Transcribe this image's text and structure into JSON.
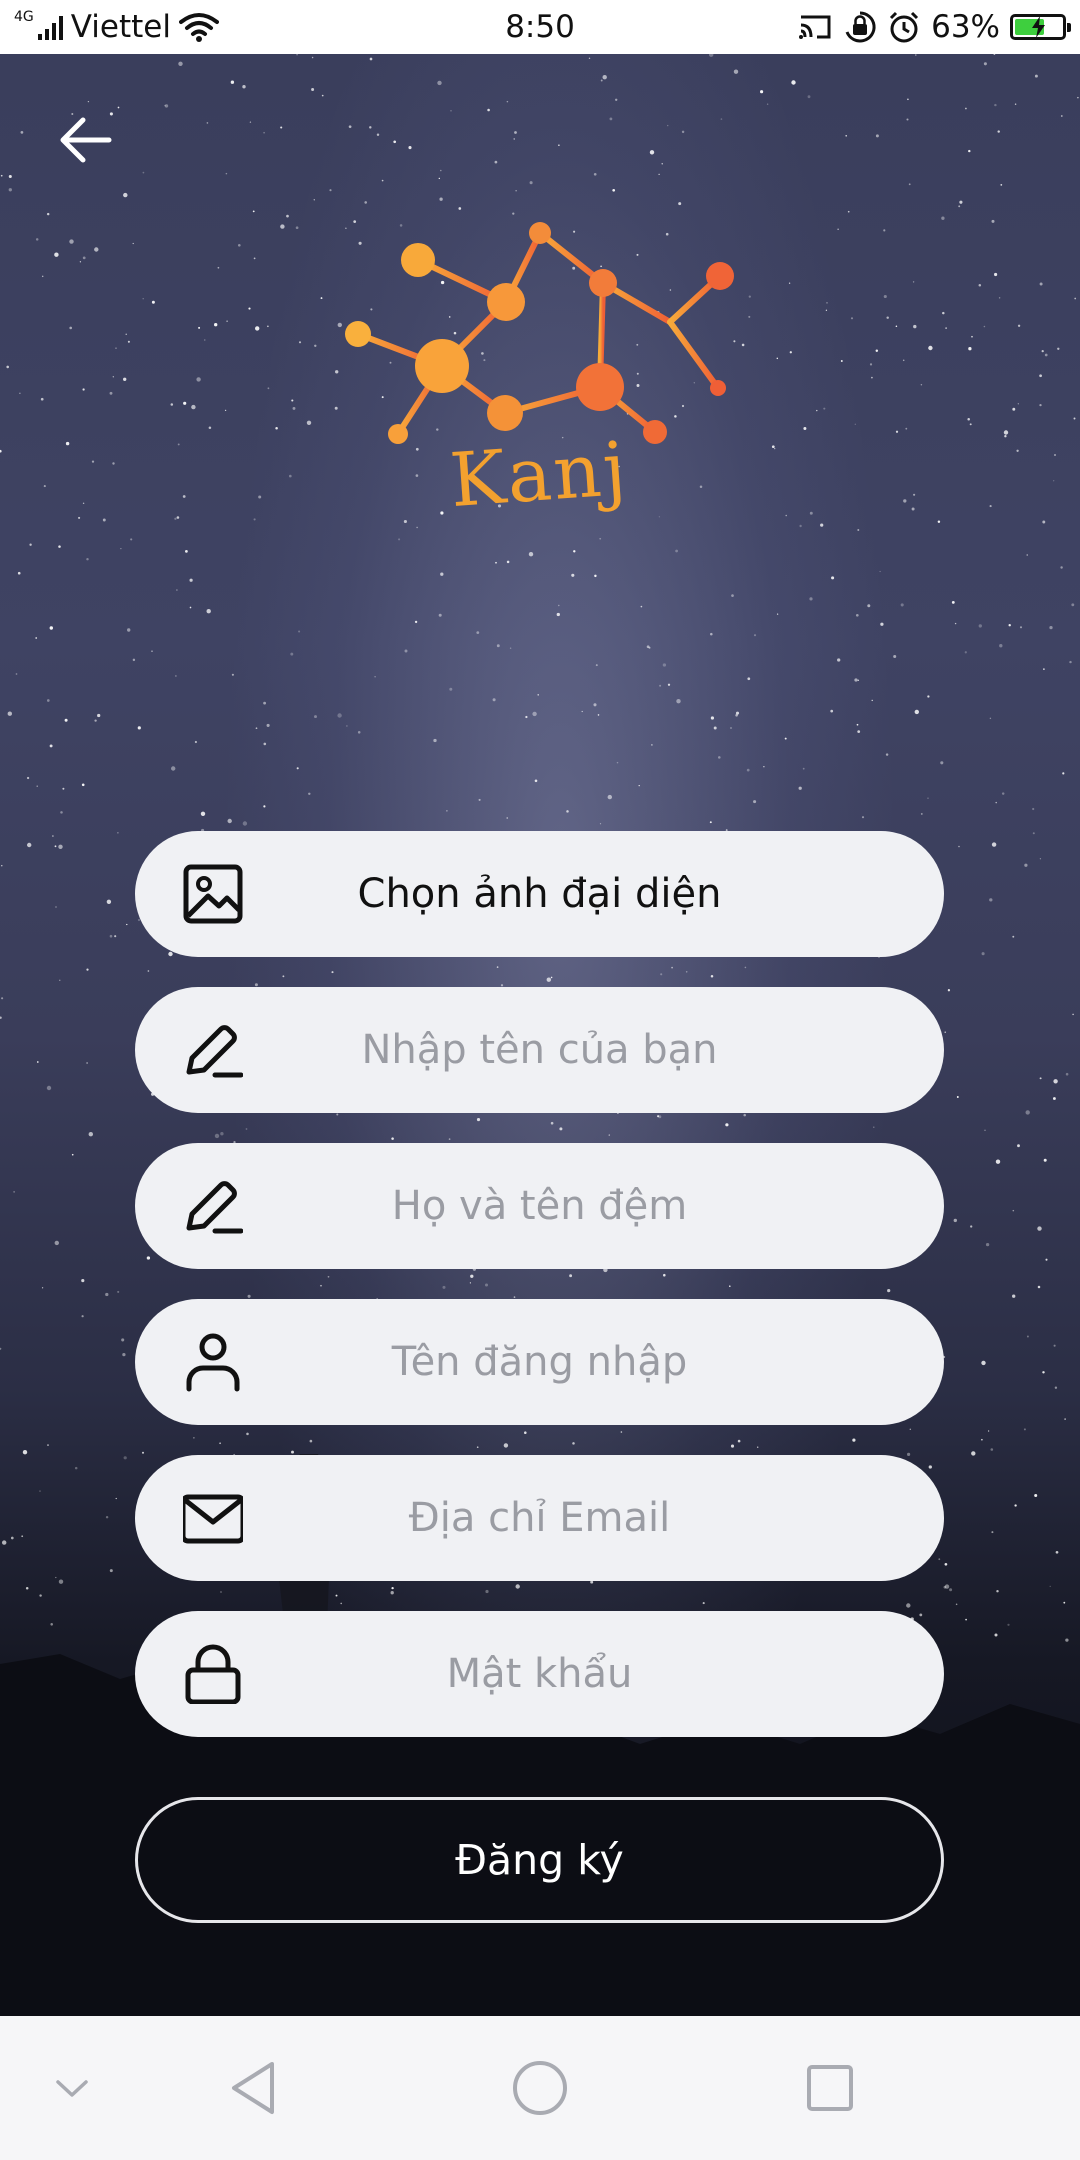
{
  "status_bar": {
    "network_type": "4G",
    "carrier": "Viettel",
    "time": "8:50",
    "battery_percent": "63%",
    "battery_level": 0.63,
    "icons": [
      "signal-icon",
      "wifi-icon",
      "cast-icon",
      "rotation-lock-icon",
      "alarm-icon",
      "battery-icon"
    ]
  },
  "header": {
    "back_icon": "arrow-left-icon"
  },
  "logo": {
    "text": "Kanj",
    "color": "#f3a12f",
    "accent": "#f26a3b"
  },
  "form": {
    "avatar": {
      "label": "Chọn ảnh đại diện",
      "icon": "image-icon"
    },
    "first_name": {
      "placeholder": "Nhập tên của bạn",
      "value": "",
      "icon": "pencil-icon"
    },
    "last_name": {
      "placeholder": "Họ và tên đệm",
      "value": "",
      "icon": "pencil-icon"
    },
    "username": {
      "placeholder": "Tên đăng nhập",
      "value": "",
      "icon": "user-icon"
    },
    "email": {
      "placeholder": "Địa chỉ Email",
      "value": "",
      "icon": "envelope-icon"
    },
    "password": {
      "placeholder": "Mật khẩu",
      "value": "",
      "icon": "lock-icon"
    },
    "submit_label": "Đăng ký"
  },
  "nav_bar": {
    "icons": [
      "chevron-down-icon",
      "back-triangle-icon",
      "home-circle-icon",
      "recents-square-icon"
    ]
  },
  "colors": {
    "field_background": "#f0f1f4",
    "placeholder": "#9a9ca3",
    "status_bar": "#ffffff",
    "nav_bar": "#f6f6f8"
  }
}
